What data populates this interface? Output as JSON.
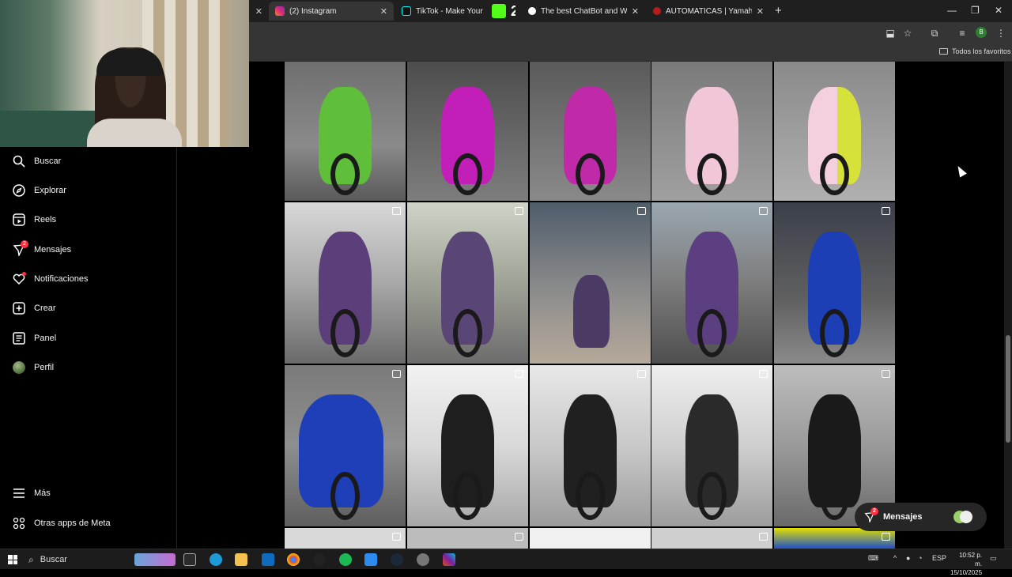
{
  "browser": {
    "tabs": [
      {
        "title": "",
        "active": false
      },
      {
        "title": "",
        "active": false
      },
      {
        "title": "(2) Instagram",
        "active": true
      },
      {
        "title": "TikTok - Make Your Day",
        "active": false
      },
      {
        "title": "2",
        "active": false
      },
      {
        "title": "The best ChatBot and Widgets",
        "active": false
      },
      {
        "title": "AUTOMATICAS | Yamaha Yamaha",
        "active": false
      }
    ],
    "bookmarks_all": "Todos los favoritos",
    "profile_initial": "B"
  },
  "sidebar": {
    "items": [
      {
        "label": "Buscar",
        "icon": "search-icon"
      },
      {
        "label": "Explorar",
        "icon": "compass-icon"
      },
      {
        "label": "Reels",
        "icon": "reels-icon"
      },
      {
        "label": "Mensajes",
        "icon": "messenger-icon",
        "badge": "2"
      },
      {
        "label": "Notificaciones",
        "icon": "heart-icon",
        "dot": true
      },
      {
        "label": "Crear",
        "icon": "plus-square-icon"
      },
      {
        "label": "Panel",
        "icon": "chart-icon"
      },
      {
        "label": "Perfil",
        "icon": "avatar"
      },
      {
        "label": "Más",
        "icon": "menu-icon"
      },
      {
        "label": "Otras apps de Meta",
        "icon": "apps-icon"
      }
    ]
  },
  "messages_pill": {
    "label": "Mensajes",
    "badge": "2"
  },
  "taskbar": {
    "search_label": "Buscar",
    "language": "ESP",
    "time": "10:52 p. m.",
    "date": "15/10/2025"
  },
  "colors": {
    "badge": "#ff3040",
    "accent": "#0095f6"
  }
}
